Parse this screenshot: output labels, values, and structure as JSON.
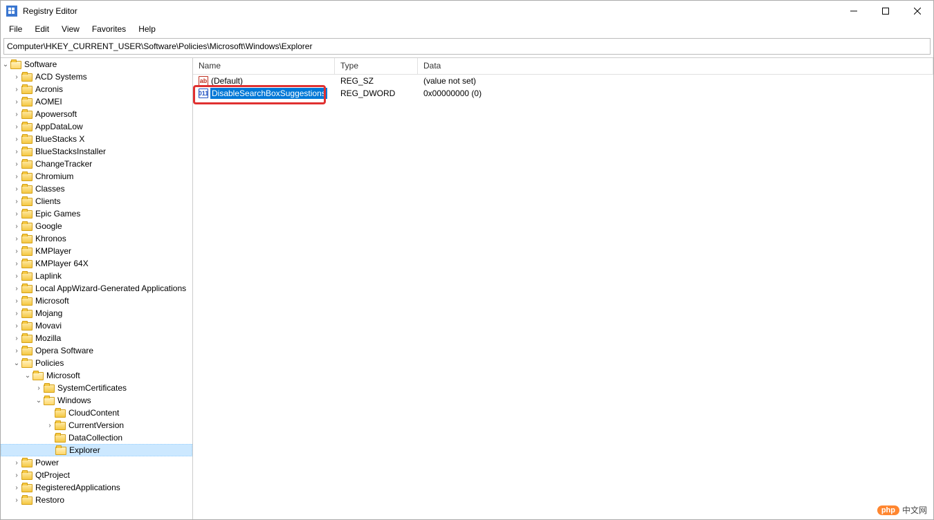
{
  "window": {
    "title": "Registry Editor"
  },
  "menu": {
    "file": "File",
    "edit": "Edit",
    "view": "View",
    "favorites": "Favorites",
    "help": "Help"
  },
  "address": "Computer\\HKEY_CURRENT_USER\\Software\\Policies\\Microsoft\\Windows\\Explorer",
  "tree": {
    "software": "Software",
    "items": [
      "ACD Systems",
      "Acronis",
      "AOMEI",
      "Apowersoft",
      "AppDataLow",
      "BlueStacks X",
      "BlueStacksInstaller",
      "ChangeTracker",
      "Chromium",
      "Classes",
      "Clients",
      "Epic Games",
      "Google",
      "Khronos",
      "KMPlayer",
      "KMPlayer 64X",
      "Laplink",
      "Local AppWizard-Generated Applications",
      "Microsoft",
      "Mojang",
      "Movavi",
      "Mozilla",
      "Opera Software"
    ],
    "policies": "Policies",
    "microsoft2": "Microsoft",
    "systemcerts": "SystemCertificates",
    "windows": "Windows",
    "windows_children": [
      "CloudContent",
      "CurrentVersion",
      "DataCollection",
      "Explorer"
    ],
    "power": "Power",
    "after": [
      "QtProject",
      "RegisteredApplications",
      "Restoro"
    ]
  },
  "list": {
    "headers": {
      "name": "Name",
      "type": "Type",
      "data": "Data"
    },
    "rows": [
      {
        "icon": "sz",
        "icon_txt": "ab",
        "name": "(Default)",
        "type": "REG_SZ",
        "data": "(value not set)",
        "editing": false
      },
      {
        "icon": "dword",
        "icon_txt": "011",
        "name": "DisableSearchBoxSuggestions",
        "type": "REG_DWORD",
        "data": "0x00000000 (0)",
        "editing": true
      }
    ]
  },
  "watermark": {
    "pill": "php",
    "text": "中文网"
  }
}
